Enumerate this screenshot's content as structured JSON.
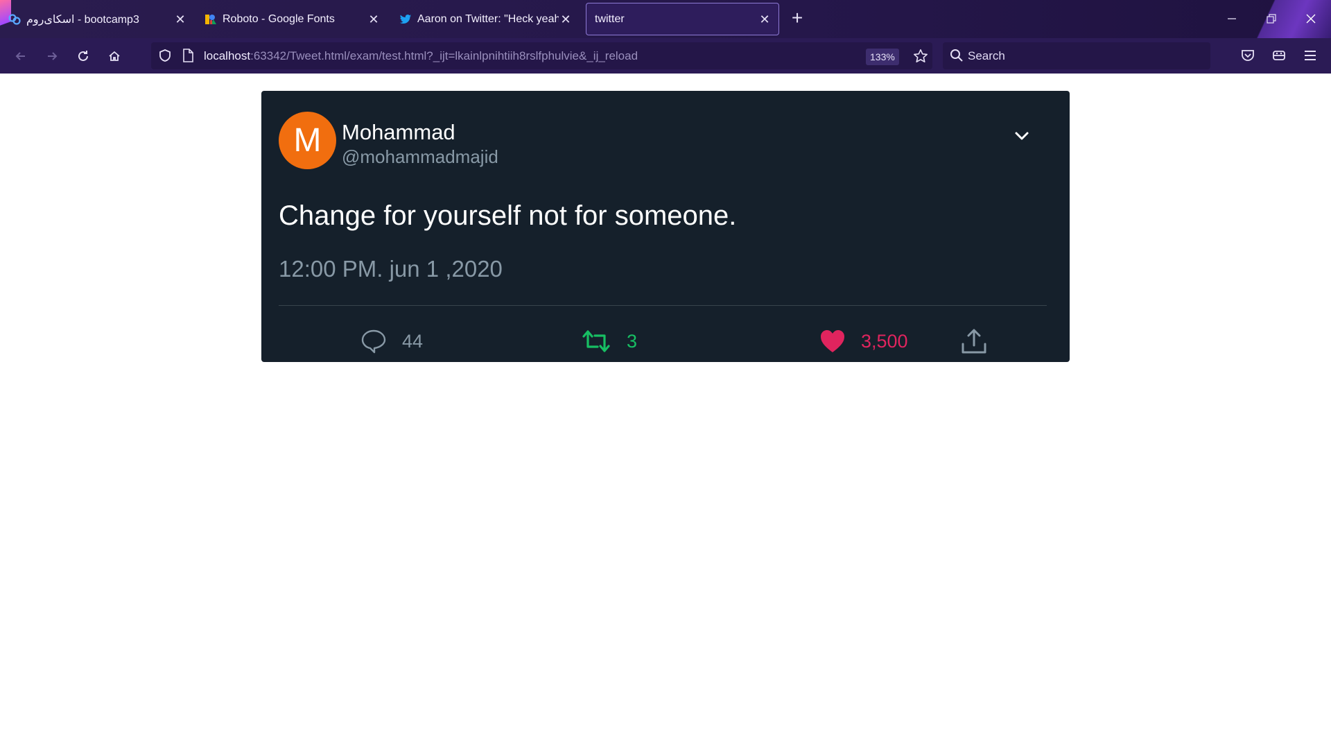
{
  "browser": {
    "tabs": [
      {
        "title": "اسکای‌روم - bootcamp3",
        "icon": "skyroom-icon"
      },
      {
        "title": "Roboto - Google Fonts",
        "icon": "google-fonts-icon"
      },
      {
        "title": "Aaron on Twitter: \"Heck yeah th",
        "icon": "twitter-bird-icon"
      },
      {
        "title": "twitter",
        "icon": "none"
      }
    ],
    "url": {
      "host": "localhost",
      "path": ":63342/Tweet.html/exam/test.html?_ijt=lkainlpnihtiih8rslfphulvie&_ij_reload"
    },
    "zoom": "133%",
    "search_placeholder": "Search"
  },
  "tweet": {
    "avatar_letter": "M",
    "avatar_color": "#f16e0f",
    "name": "Mohammad",
    "handle": "@mohammadmajid",
    "text": "Change for yourself not for someone.",
    "timestamp": "12:00 PM. jun 1 ,2020",
    "replies": "44",
    "retweets": "3",
    "likes": "3,500",
    "colors": {
      "card_bg": "#15202b",
      "reply": "#8899a6",
      "retweet": "#17bf63",
      "like": "#e0245e"
    }
  }
}
